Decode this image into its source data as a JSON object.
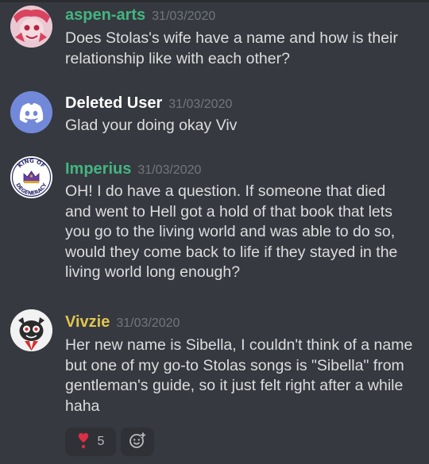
{
  "colors": {
    "background": "#36393f",
    "text": "#dcddde",
    "timestamp": "#72767d",
    "green_name": "#43b581",
    "white_name": "#ffffff",
    "yellow_name": "#e0c54f",
    "discord_blurple": "#7289da"
  },
  "messages": [
    {
      "username": "aspen-arts",
      "timestamp": "31/03/2020",
      "text": "Does Stolas's wife have a name and how is their relationship like with each other?",
      "avatar_icon": "pink-character-avatar"
    },
    {
      "username": "Deleted User",
      "timestamp": "31/03/2020",
      "text": "Glad your doing okay Viv",
      "avatar_icon": "discord-logo-avatar"
    },
    {
      "username": "Imperius",
      "timestamp": "31/03/2020",
      "text": "OH!  I do have a question.  If someone that died and went to Hell got a hold of that book that lets you go to the living world and was able to do so, would they come back to life if they stayed in the living world long enough?",
      "avatar_icon": "king-of-degeneracy-badge",
      "avatar_text_top": "KING OF",
      "avatar_text_bottom": "DEGENERACY"
    },
    {
      "username": "Vivzie",
      "timestamp": "31/03/2020",
      "text": "Her new name is Sibella, I couldn't think of a name but one of my go-to Stolas songs is \"Sibella\" from gentleman's guide, so it just felt right after a while haha",
      "avatar_icon": "cartoon-character-avatar"
    }
  ],
  "reactions": [
    {
      "emoji": "heart-exclamation-icon",
      "count": "5"
    },
    {
      "emoji": "add-reaction-icon"
    }
  ]
}
